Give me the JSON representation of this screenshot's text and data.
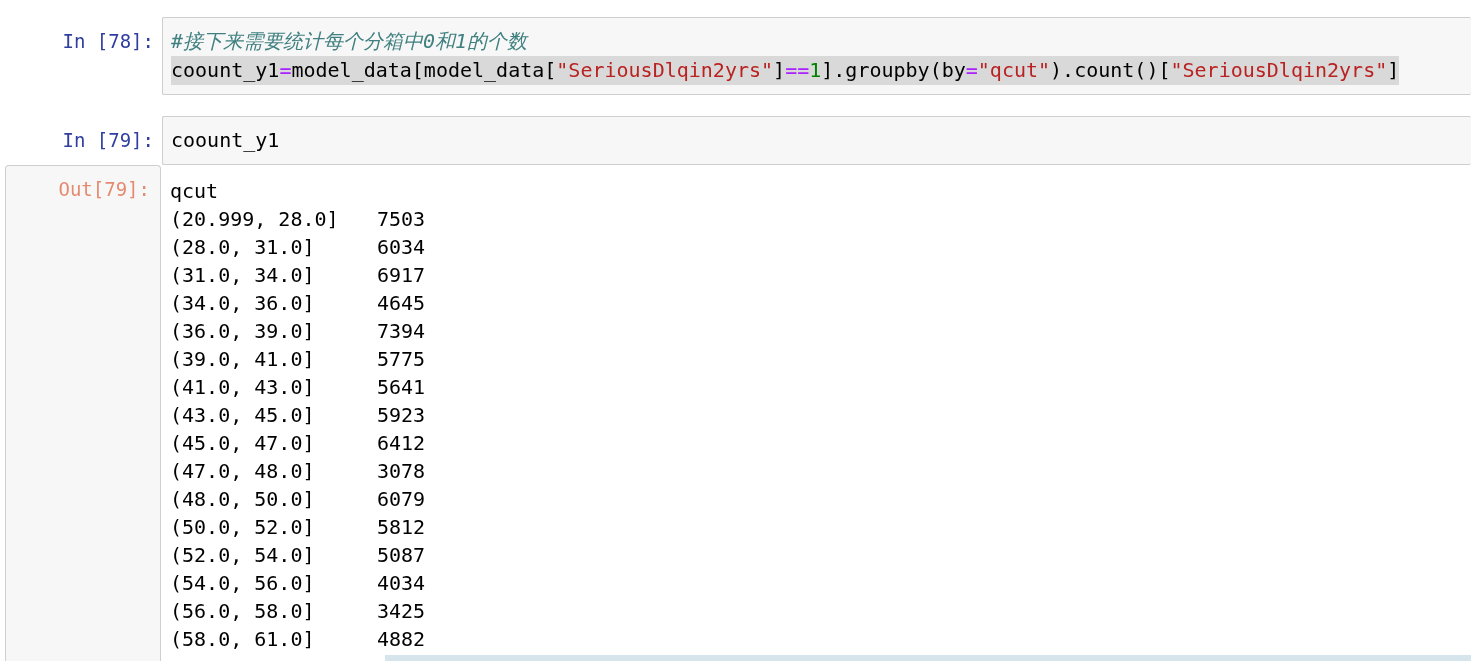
{
  "cells": [
    {
      "kind": "input",
      "prompt": "In [78]:",
      "lines": [
        {
          "selected": false,
          "tokens": [
            {
              "kind": "comment",
              "text": "#接下来需要统计每个分箱中0和1的个数"
            }
          ]
        },
        {
          "selected": true,
          "tokens": [
            {
              "kind": "name",
              "text": "coount_y1"
            },
            {
              "kind": "operator",
              "text": "="
            },
            {
              "kind": "name",
              "text": "model_data[model_data["
            },
            {
              "kind": "string",
              "text": "\"SeriousDlqin2yrs\""
            },
            {
              "kind": "name",
              "text": "]"
            },
            {
              "kind": "operator",
              "text": "=="
            },
            {
              "kind": "number",
              "text": "1"
            },
            {
              "kind": "name",
              "text": "].groupby(by"
            },
            {
              "kind": "operator",
              "text": "="
            },
            {
              "kind": "string",
              "text": "\"qcut\""
            },
            {
              "kind": "name",
              "text": ").count()["
            },
            {
              "kind": "string",
              "text": "\"SeriousDlqin2yrs\""
            },
            {
              "kind": "name",
              "text": "]"
            }
          ]
        }
      ]
    },
    {
      "kind": "input",
      "prompt": "In [79]:",
      "lines": [
        {
          "selected": false,
          "tokens": [
            {
              "kind": "name",
              "text": "coount_y1"
            }
          ]
        }
      ]
    },
    {
      "kind": "output",
      "prompt": "Out[79]:",
      "header": "qcut",
      "rows": [
        {
          "interval": "(20.999, 28.0]",
          "count": "7503"
        },
        {
          "interval": "(28.0, 31.0]",
          "count": "6034"
        },
        {
          "interval": "(31.0, 34.0]",
          "count": "6917"
        },
        {
          "interval": "(34.0, 36.0]",
          "count": "4645"
        },
        {
          "interval": "(36.0, 39.0]",
          "count": "7394"
        },
        {
          "interval": "(39.0, 41.0]",
          "count": "5775"
        },
        {
          "interval": "(41.0, 43.0]",
          "count": "5641"
        },
        {
          "interval": "(43.0, 45.0]",
          "count": "5923"
        },
        {
          "interval": "(45.0, 47.0]",
          "count": "6412"
        },
        {
          "interval": "(47.0, 48.0]",
          "count": "3078"
        },
        {
          "interval": "(48.0, 50.0]",
          "count": "6079"
        },
        {
          "interval": "(50.0, 52.0]",
          "count": "5812"
        },
        {
          "interval": "(52.0, 54.0]",
          "count": "5087"
        },
        {
          "interval": "(54.0, 56.0]",
          "count": "4034"
        },
        {
          "interval": "(56.0, 58.0]",
          "count": "3425"
        },
        {
          "interval": "(58.0, 61.0]",
          "count": "4882"
        }
      ]
    }
  ]
}
